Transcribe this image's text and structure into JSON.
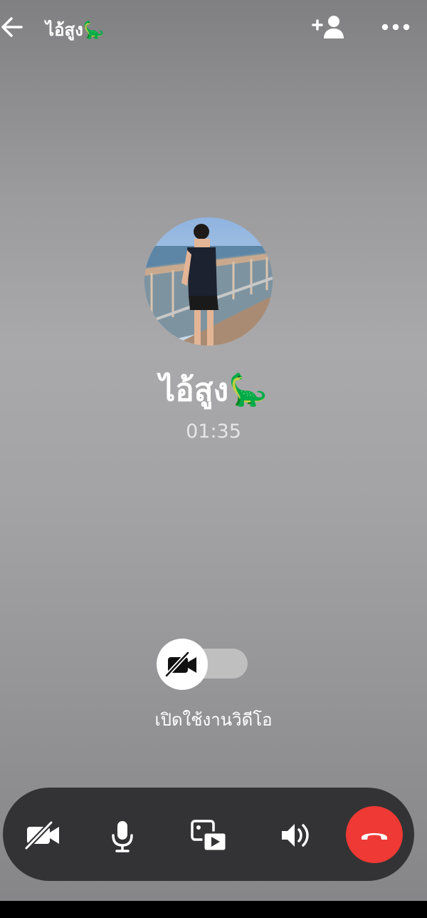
{
  "header": {
    "contact_name": "ไอ้สูง🦕",
    "back_icon": "arrow-left-icon",
    "add_user_icon": "add-person-icon",
    "more_icon": "more-horizontal-icon"
  },
  "call": {
    "contact_name": "ไอ้สูง🦕",
    "duration": "01:35"
  },
  "video_toggle": {
    "label": "เปิดใช้งานวิดีโอ",
    "enabled": false,
    "icon": "video-off-icon"
  },
  "controls": [
    {
      "id": "video",
      "icon": "video-off-icon"
    },
    {
      "id": "mic",
      "icon": "microphone-icon"
    },
    {
      "id": "share",
      "icon": "screen-share-icon"
    },
    {
      "id": "speaker",
      "icon": "speaker-icon"
    },
    {
      "id": "end",
      "icon": "hang-up-icon"
    }
  ],
  "colors": {
    "end_call": "#ef3934",
    "bar": "#333335"
  }
}
